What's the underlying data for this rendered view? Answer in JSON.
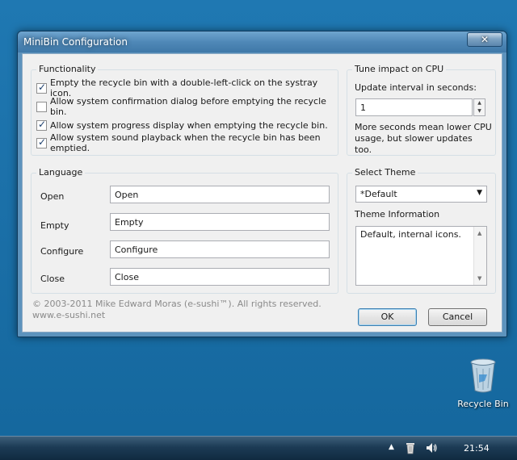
{
  "window": {
    "title": "MiniBin Configuration",
    "close_symbol": "✕"
  },
  "functionality": {
    "title": "Functionality",
    "options": [
      {
        "label": "Empty the recycle bin with a double-left-click on the systray icon.",
        "checked": true
      },
      {
        "label": "Allow system confirmation dialog before emptying the recycle bin.",
        "checked": false
      },
      {
        "label": "Allow system progress display when emptying the recycle bin.",
        "checked": true
      },
      {
        "label": "Allow system sound playback when the recycle bin has been emptied.",
        "checked": true
      }
    ]
  },
  "cpu": {
    "title": "Tune impact on CPU",
    "interval_label": "Update interval in seconds:",
    "interval_value": "1",
    "note": "More seconds mean lower CPU usage, but slower updates too."
  },
  "language": {
    "title": "Language",
    "rows": [
      {
        "label": "Open",
        "value": "Open"
      },
      {
        "label": "Empty",
        "value": "Empty"
      },
      {
        "label": "Configure",
        "value": "Configure"
      },
      {
        "label": "Close",
        "value": "Close"
      }
    ]
  },
  "theme": {
    "title": "Select Theme",
    "selected": "*Default",
    "info_label": "Theme Information",
    "info_text": "Default, internal icons."
  },
  "footer": {
    "copyright": "© 2003-2011 Mike Edward Moras (e-sushi™). All rights reserved.",
    "website": "www.e-sushi.net"
  },
  "buttons": {
    "ok": "OK",
    "cancel": "Cancel"
  },
  "desktop": {
    "recycle_bin_label": "Recycle Bin"
  },
  "taskbar": {
    "clock": "21:54"
  }
}
